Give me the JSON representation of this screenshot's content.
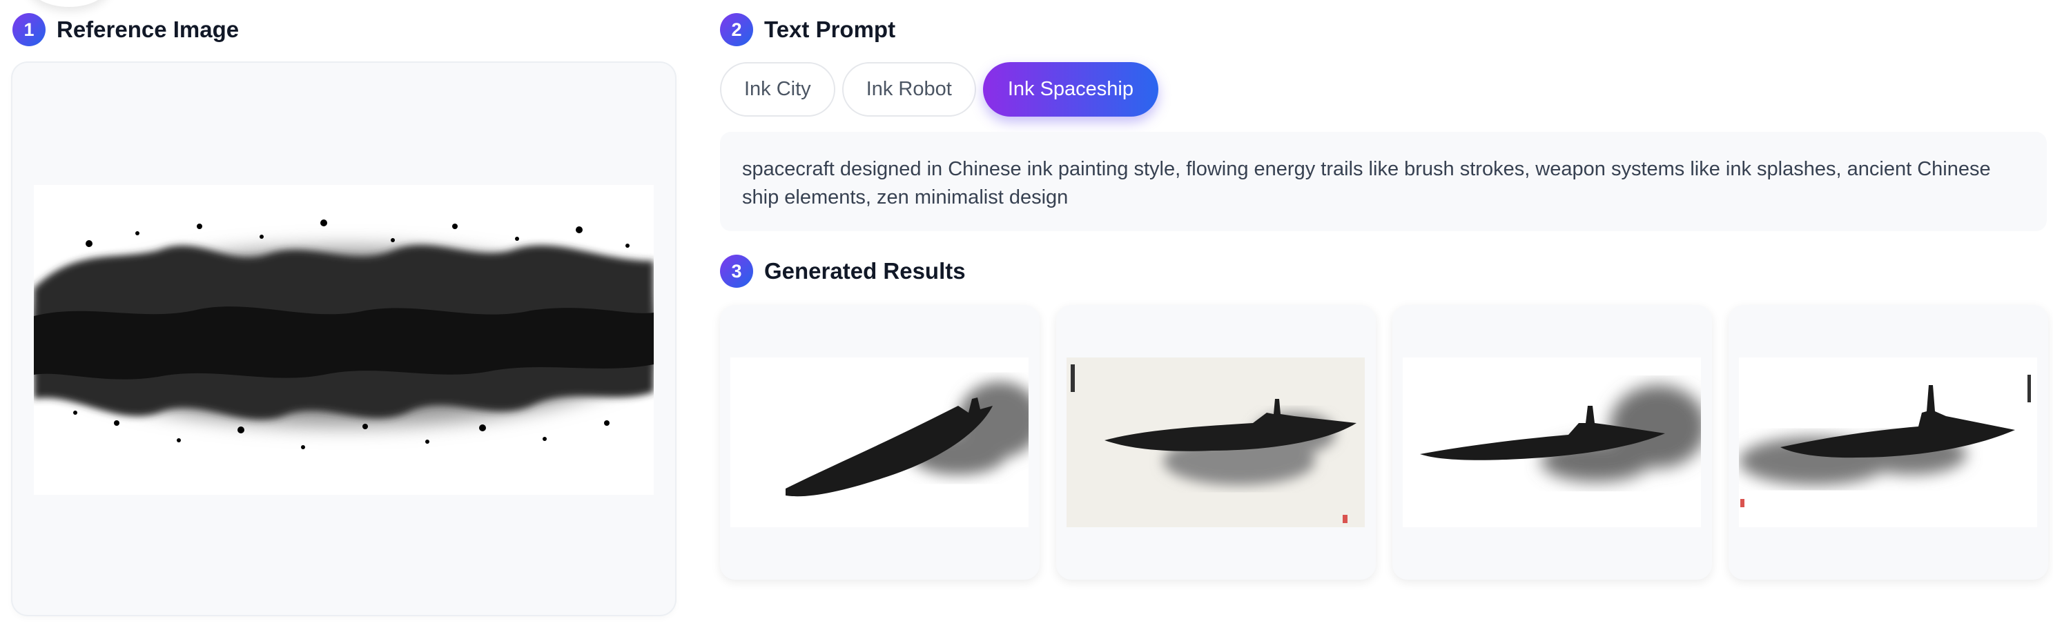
{
  "reference": {
    "step": "1",
    "title": "Reference Image"
  },
  "prompt": {
    "step": "2",
    "title": "Text Prompt",
    "chips": [
      {
        "label": "Ink City",
        "active": false
      },
      {
        "label": "Ink Robot",
        "active": false
      },
      {
        "label": "Ink Spaceship",
        "active": true
      }
    ],
    "text": "spacecraft designed in Chinese ink painting style, flowing energy trails like brush strokes, weapon systems like ink splashes, ancient Chinese ship elements, zen minimalist design"
  },
  "results": {
    "step": "3",
    "title": "Generated Results"
  },
  "colors": {
    "accent_start": "#8b2ee8",
    "accent_end": "#2b66ef",
    "panel_bg": "#f8f9fb"
  }
}
